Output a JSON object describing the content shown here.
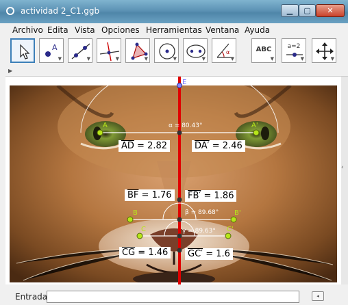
{
  "window": {
    "title": "actividad 2_C1.ggb"
  },
  "menu": [
    "Archivo",
    "Edita",
    "Vista",
    "Opciones",
    "Herramientas",
    "Ventana",
    "Ayuda"
  ],
  "toolbar": {
    "text_tool_label": "ABC",
    "slider_tool_label": "a=2"
  },
  "graphics": {
    "point_labels": [
      "E",
      "A",
      "A'",
      "B",
      "B'",
      "C",
      "C'"
    ],
    "angle_labels": {
      "alpha": "α = 80.43°",
      "beta": "β = 89.68°",
      "gamma": "γ = 89.63°"
    },
    "segments": {
      "AD": {
        "name": "AD",
        "value": " = 2.82"
      },
      "DA": {
        "name": "DA′",
        "value": " = 2.46"
      },
      "BF": {
        "name": "BF",
        "value": " = 1.76"
      },
      "FB": {
        "name": "FB′",
        "value": " = 1.86"
      },
      "CG": {
        "name": "CG",
        "value": " = 1.46"
      },
      "GC": {
        "name": "GC′",
        "value": " = 1.6"
      }
    }
  },
  "input_bar": {
    "label": "Entrada:",
    "value": ""
  },
  "colors": {
    "axis_line": "#e00000",
    "segment_line": "#ffffff",
    "point": "#b7e61a",
    "angle_arc": "#ffffff"
  }
}
